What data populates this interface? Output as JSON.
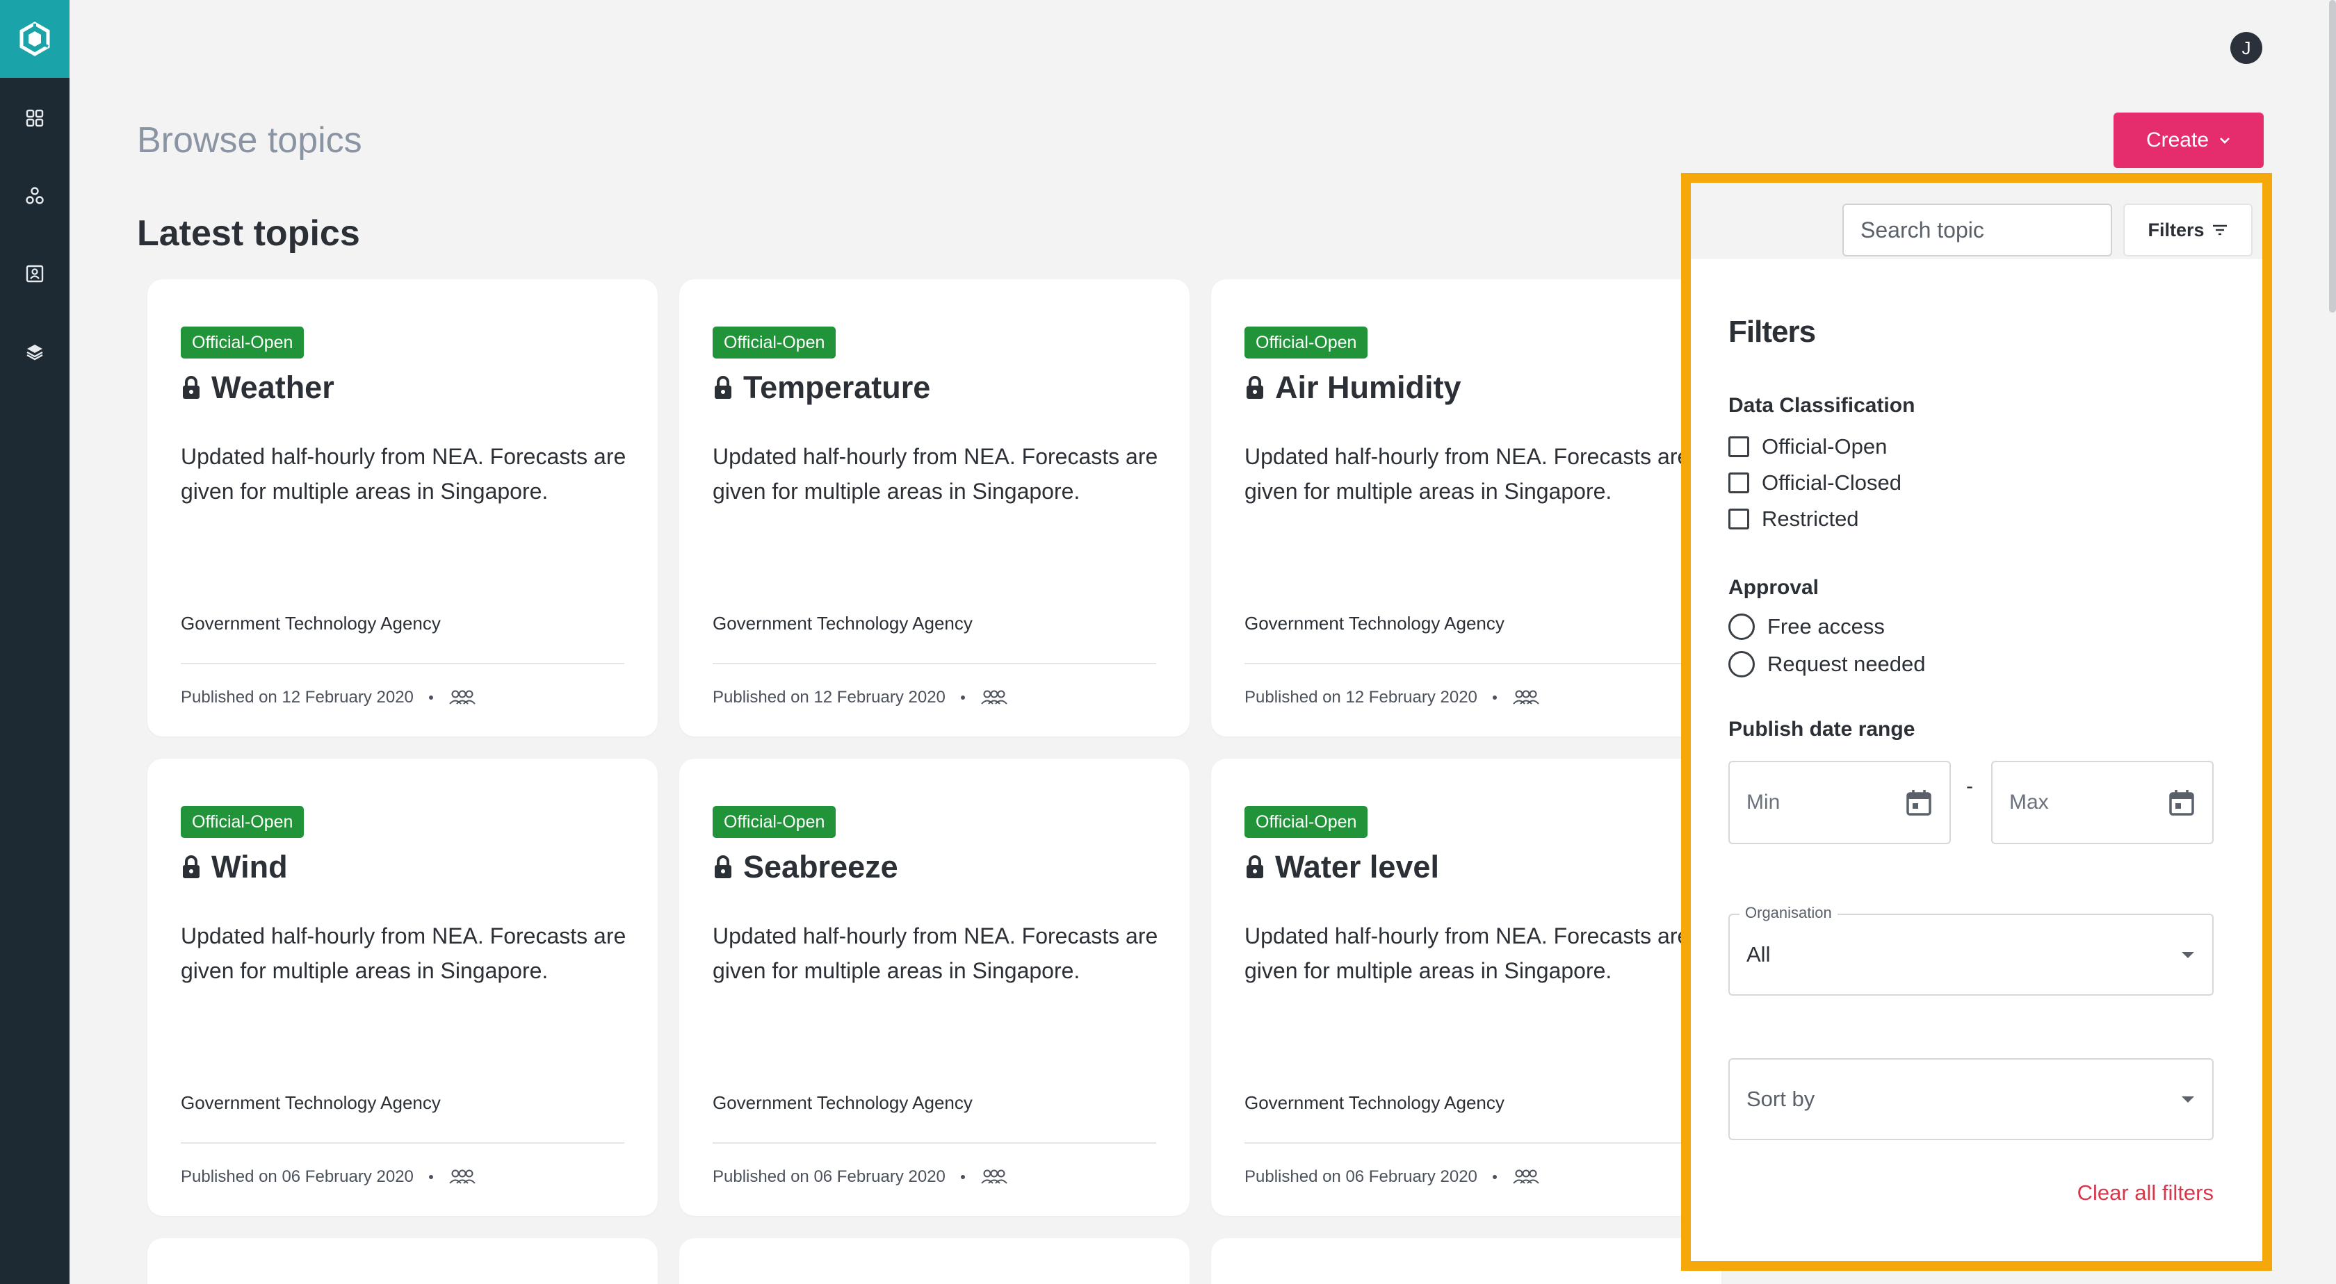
{
  "user": {
    "initial": "J"
  },
  "header": {
    "title": "Browse topics",
    "create_label": "Create"
  },
  "section": {
    "title": "Latest topics"
  },
  "cards": [
    {
      "badge": "Official-Open",
      "title": "Weather",
      "description": "Updated half-hourly from NEA. Forecasts are given for multiple areas in Singapore.",
      "org": "Government Technology Agency",
      "published": "Published on 12 February 2020"
    },
    {
      "badge": "Official-Open",
      "title": "Temperature",
      "description": "Updated half-hourly from NEA. Forecasts are given for multiple areas in Singapore.",
      "org": "Government Technology Agency",
      "published": "Published on 12 February 2020"
    },
    {
      "badge": "Official-Open",
      "title": "Air Humidity",
      "description": "Updated half-hourly from NEA. Forecasts are given for multiple areas in Singapore.",
      "org": "Government Technology Agency",
      "published": "Published on 12 February 2020"
    },
    {
      "badge": "Official-Open",
      "title": "Wind",
      "description": "Updated half-hourly from NEA. Forecasts are given for multiple areas in Singapore.",
      "org": "Government Technology Agency",
      "published": "Published on 06 February 2020"
    },
    {
      "badge": "Official-Open",
      "title": "Seabreeze",
      "description": "Updated half-hourly from NEA. Forecasts are given for multiple areas in Singapore.",
      "org": "Government Technology Agency",
      "published": "Published on 06 February 2020"
    },
    {
      "badge": "Official-Open",
      "title": "Water level",
      "description": "Updated half-hourly from NEA. Forecasts are given for multiple areas in Singapore.",
      "org": "Government Technology Agency",
      "published": "Published on 06 February 2020"
    }
  ],
  "filters": {
    "search_placeholder": "Search topic",
    "toggle_label": "Filters",
    "heading": "Filters",
    "classification": {
      "label": "Data Classification",
      "options": [
        "Official-Open",
        "Official-Closed",
        "Restricted"
      ]
    },
    "approval": {
      "label": "Approval",
      "options": [
        "Free access",
        "Request needed"
      ]
    },
    "date_range": {
      "label": "Publish date range",
      "min_placeholder": "Min",
      "max_placeholder": "Max",
      "separator": "-"
    },
    "organisation": {
      "label": "Organisation",
      "value": "All"
    },
    "sort": {
      "placeholder": "Sort by"
    },
    "clear_label": "Clear all filters"
  },
  "colors": {
    "sidebar": "#1e2a33",
    "logo_bg": "#1aa3a8",
    "create_button": "#e52d6e",
    "badge": "#21943a",
    "highlight_outline": "#f4a80a",
    "clear_link": "#d7374b"
  },
  "icons": {
    "sidebar": [
      "grid-icon",
      "molecule-icon",
      "contact-card-icon",
      "layers-icon"
    ],
    "card": [
      "lock-icon",
      "group-icon"
    ]
  }
}
